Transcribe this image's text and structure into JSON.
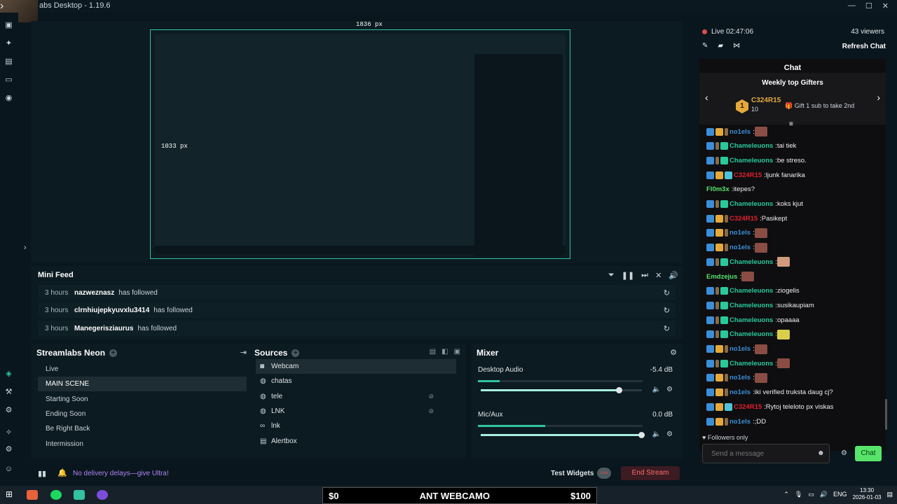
{
  "window": {
    "title": "abs Desktop - 1.19.6",
    "min": "—",
    "max": "☐",
    "close": "✕",
    "collapse": "›"
  },
  "editor": {
    "width_label": "1836 px",
    "height_label": "1033 px"
  },
  "minifeed": {
    "title": "Mini Feed",
    "rows": [
      {
        "time": "3 hours",
        "user": "nazweznasz",
        "action": "has followed"
      },
      {
        "time": "3 hours",
        "user": "clrnhiujepkyuvxlu3414",
        "action": "has followed"
      },
      {
        "time": "3 hours",
        "user": "Manegerisziaurus",
        "action": "has followed"
      }
    ]
  },
  "scenes": {
    "title": "Streamlabs Neon",
    "items": [
      "Live",
      "MAIN SCENE",
      "Starting Soon",
      "Ending Soon",
      "Be Right Back",
      "Intermission"
    ],
    "active_index": 1
  },
  "sources": {
    "title": "Sources",
    "items": [
      {
        "label": "Webcam",
        "icon": "camera-icon"
      },
      {
        "label": "chatas",
        "icon": "globe-icon"
      },
      {
        "label": "tele",
        "icon": "globe-icon",
        "hidden": true
      },
      {
        "label": "LNK",
        "icon": "globe-icon",
        "hidden": true
      },
      {
        "label": "lnk",
        "icon": "link-icon"
      },
      {
        "label": "Alertbox",
        "icon": "alert-icon"
      }
    ]
  },
  "mixer": {
    "title": "Mixer",
    "channels": [
      {
        "name": "Desktop Audio",
        "db": "-5.4 dB",
        "level": 0.13,
        "volume": 0.86
      },
      {
        "name": "Mic/Aux",
        "db": "0.0 dB",
        "level": 0.41,
        "volume": 1.0
      }
    ]
  },
  "footer": {
    "ultra_text": "No delivery delays—give Ultra!",
    "test_widgets": "Test Widgets",
    "test_toggle": "Live",
    "end_stream": "End Stream"
  },
  "chat": {
    "live": "Live 02:47:06",
    "viewers": "43 viewers",
    "refresh": "Refresh Chat",
    "title": "Chat",
    "gifters_title": "Weekly top Gifters",
    "top_gifter": {
      "rank": "1",
      "name": "C324R15",
      "count": "10"
    },
    "gift_hint": "Gift 1 sub to take 2nd",
    "followers_only": "Followers only",
    "placeholder": "Send a message",
    "send": "Chat",
    "messages": [
      {
        "badges": [
          "blue",
          "crown",
          "bits"
        ],
        "user": "no1els",
        "color": "#3b8ed8",
        "text": "",
        "emote": "emote"
      },
      {
        "badges": [
          "blue",
          "bits",
          "teal"
        ],
        "user": "Chameleuons",
        "color": "#29c99c",
        "text": "tai tiek"
      },
      {
        "badges": [
          "blue",
          "bits",
          "teal"
        ],
        "user": "Chameleuons",
        "color": "#29c99c",
        "text": "be streso."
      },
      {
        "badges": [
          "blue",
          "crown",
          "cyan"
        ],
        "user": "C324R15",
        "color": "#e0202f",
        "text": "ljunk fanarika"
      },
      {
        "badges": [],
        "user": "Fl0m3x",
        "color": "#58e46b",
        "text": "itepes?"
      },
      {
        "badges": [
          "blue",
          "bits",
          "teal"
        ],
        "user": "Chameleuons",
        "color": "#29c99c",
        "text": "koks kjut"
      },
      {
        "badges": [
          "blue",
          "crown",
          "bits"
        ],
        "user": "C324R15",
        "color": "#e0202f",
        "text": "Pasikept"
      },
      {
        "badges": [
          "blue",
          "crown",
          "bits"
        ],
        "user": "no1els",
        "color": "#3b8ed8",
        "text": "",
        "emote": "emote"
      },
      {
        "badges": [
          "blue",
          "crown",
          "bits"
        ],
        "user": "no1els",
        "color": "#3b8ed8",
        "text": "",
        "emote": "emote"
      },
      {
        "badges": [
          "blue",
          "bits",
          "teal"
        ],
        "user": "Chameleuons",
        "color": "#29c99c",
        "text": "",
        "emote": "face"
      },
      {
        "badges": [],
        "user": "Emdzejus",
        "color": "#58e46b",
        "text": "",
        "emote": "emote"
      },
      {
        "badges": [
          "blue",
          "bits",
          "teal"
        ],
        "user": "Chameleuons",
        "color": "#29c99c",
        "text": "ziogelis"
      },
      {
        "badges": [
          "blue",
          "bits",
          "teal"
        ],
        "user": "Chameleuons",
        "color": "#29c99c",
        "text": "susikaupiam"
      },
      {
        "badges": [
          "blue",
          "bits",
          "teal"
        ],
        "user": "Chameleuons",
        "color": "#29c99c",
        "text": "opaaaa"
      },
      {
        "badges": [
          "blue",
          "bits",
          "teal"
        ],
        "user": "Chameleuons",
        "color": "#29c99c",
        "text": "",
        "emote": "yellow"
      },
      {
        "badges": [
          "blue",
          "crown",
          "bits"
        ],
        "user": "no1els",
        "color": "#3b8ed8",
        "text": "",
        "emote": "emote"
      },
      {
        "badges": [
          "blue",
          "bits",
          "teal"
        ],
        "user": "Chameleuons",
        "color": "#29c99c",
        "text": "",
        "emote": "emote"
      },
      {
        "badges": [
          "blue",
          "crown",
          "bits"
        ],
        "user": "no1els",
        "color": "#3b8ed8",
        "text": "",
        "emote": "emote"
      },
      {
        "badges": [
          "blue",
          "crown",
          "bits"
        ],
        "user": "no1els",
        "color": "#3b8ed8",
        "text": "iki verified truksta daug cj?"
      },
      {
        "badges": [
          "blue",
          "crown",
          "cyan"
        ],
        "user": "C324R15",
        "color": "#e0202f",
        "text": "Rytoj teleloto px viskas"
      },
      {
        "badges": [
          "blue",
          "crown",
          "bits"
        ],
        "user": "no1els",
        "color": "#3b8ed8",
        "text": ";DD"
      }
    ]
  },
  "overlay_bar": {
    "left": "$0",
    "center": "ANT WEBCAMO",
    "right": "$100"
  },
  "taskbar": {
    "lang": "ENG",
    "time": "13:30",
    "date": "2026-01-03"
  }
}
